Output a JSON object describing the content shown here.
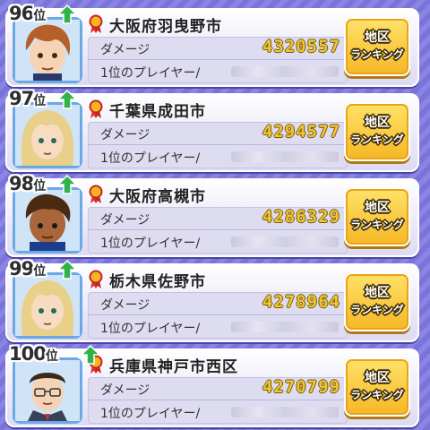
{
  "rankings": [
    {
      "rank": "96",
      "rank_suffix": "位",
      "rank_change": "up",
      "avatar": "brown-haired-boy",
      "city": "大阪府羽曳野市",
      "damage_label": "ダメージ",
      "damage": "4320557",
      "top_player_label": "1位のプレイヤー/",
      "button_line1": "地区",
      "button_line2": "ランキング"
    },
    {
      "rank": "97",
      "rank_suffix": "位",
      "rank_change": "up",
      "avatar": "blonde-long-hair-boy",
      "city": "千葉県成田市",
      "damage_label": "ダメージ",
      "damage": "4294577",
      "top_player_label": "1位のプレイヤー/",
      "button_line1": "地区",
      "button_line2": "ランキング"
    },
    {
      "rank": "98",
      "rank_suffix": "位",
      "rank_change": "up",
      "avatar": "dark-skin-boy",
      "city": "大阪府高槻市",
      "damage_label": "ダメージ",
      "damage": "4286329",
      "top_player_label": "1位のプレイヤー/",
      "button_line1": "地区",
      "button_line2": "ランキング"
    },
    {
      "rank": "99",
      "rank_suffix": "位",
      "rank_change": "up",
      "avatar": "blonde-long-hair-boy",
      "city": "栃木県佐野市",
      "damage_label": "ダメージ",
      "damage": "4278964",
      "top_player_label": "1位のプレイヤー/",
      "button_line1": "地区",
      "button_line2": "ランキング"
    },
    {
      "rank": "100",
      "rank_suffix": "位",
      "rank_change": "up",
      "avatar": "man-with-glasses",
      "city": "兵庫県神戸市西区",
      "damage_label": "ダメージ",
      "damage": "4270799",
      "top_player_label": "1位のプレイヤー/",
      "button_line1": "地区",
      "button_line2": "ランキング"
    }
  ],
  "colors": {
    "background": "#7a73d9",
    "button": "#f5b623",
    "damage_text": "#f4c531",
    "rank_up": "#2fb34a"
  }
}
